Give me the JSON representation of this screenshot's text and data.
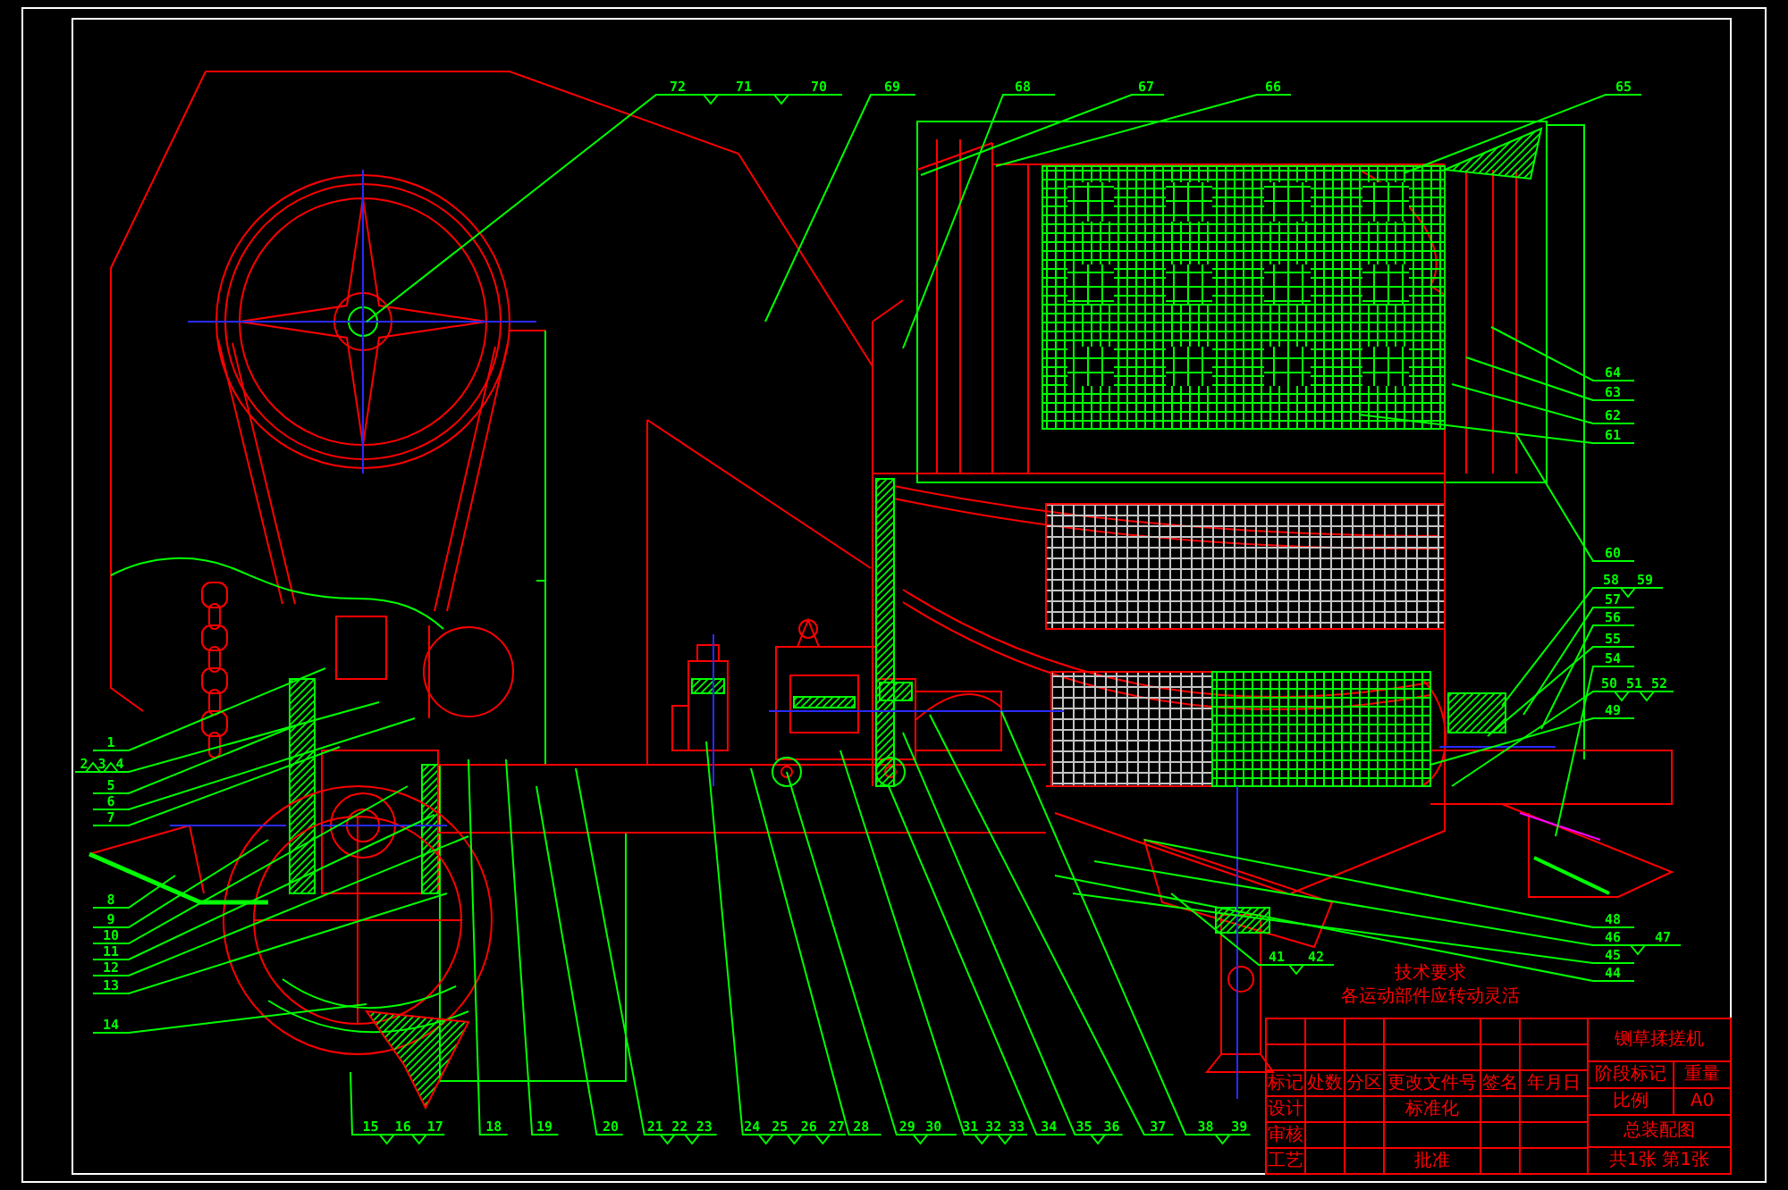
{
  "callouts": {
    "top": [
      {
        "numbers": [
          "72",
          "71",
          "70"
        ]
      },
      {
        "numbers": [
          "69"
        ]
      },
      {
        "numbers": [
          "68"
        ]
      },
      {
        "numbers": [
          "67"
        ]
      },
      {
        "numbers": [
          "66"
        ]
      },
      {
        "numbers": [
          "65"
        ]
      }
    ],
    "left": [
      {
        "numbers": [
          "1"
        ]
      },
      {
        "numbers": [
          "2",
          "3",
          "4"
        ]
      },
      {
        "numbers": [
          "5"
        ]
      },
      {
        "numbers": [
          "6"
        ]
      },
      {
        "numbers": [
          "7"
        ]
      },
      {
        "numbers": [
          "8"
        ]
      },
      {
        "numbers": [
          "9"
        ]
      },
      {
        "numbers": [
          "10"
        ]
      },
      {
        "numbers": [
          "11"
        ]
      },
      {
        "numbers": [
          "12"
        ]
      },
      {
        "numbers": [
          "13"
        ]
      },
      {
        "numbers": [
          "14"
        ]
      }
    ],
    "bottom": [
      {
        "numbers": [
          "15",
          "16",
          "17"
        ]
      },
      {
        "numbers": [
          "18"
        ]
      },
      {
        "numbers": [
          "19"
        ]
      },
      {
        "numbers": [
          "20"
        ]
      },
      {
        "numbers": [
          "21",
          "22",
          "23"
        ]
      },
      {
        "numbers": [
          "24",
          "25",
          "26",
          "27"
        ]
      },
      {
        "numbers": [
          "28"
        ]
      },
      {
        "numbers": [
          "29",
          "30"
        ]
      },
      {
        "numbers": [
          "31",
          "32",
          "33"
        ]
      },
      {
        "numbers": [
          "34"
        ]
      },
      {
        "numbers": [
          "35",
          "36"
        ]
      },
      {
        "numbers": [
          "37"
        ]
      },
      {
        "numbers": [
          "38",
          "39"
        ]
      }
    ],
    "lower_right": [
      {
        "numbers": [
          "41",
          "42"
        ]
      }
    ],
    "right": [
      {
        "numbers": [
          "64"
        ]
      },
      {
        "numbers": [
          "63"
        ]
      },
      {
        "numbers": [
          "62"
        ]
      },
      {
        "numbers": [
          "61"
        ]
      },
      {
        "numbers": [
          "60"
        ]
      },
      {
        "numbers": [
          "58",
          "59"
        ]
      },
      {
        "numbers": [
          "57"
        ]
      },
      {
        "numbers": [
          "56"
        ]
      },
      {
        "numbers": [
          "55"
        ]
      },
      {
        "numbers": [
          "54"
        ]
      },
      {
        "numbers": [
          "50",
          "51",
          "52"
        ]
      },
      {
        "numbers": [
          "49"
        ]
      },
      {
        "numbers": [
          "48"
        ]
      },
      {
        "numbers": [
          "46",
          "47"
        ]
      },
      {
        "numbers": [
          "45"
        ]
      },
      {
        "numbers": [
          "44"
        ]
      }
    ]
  },
  "technical_requirements": {
    "title": "技术要求",
    "text": "各运动部件应转动灵活"
  },
  "title_block": {
    "change_table_headers": [
      "标记",
      "处数",
      "分区",
      "更改文件号",
      "签名",
      "年月日"
    ],
    "signature_rows": [
      {
        "labels": [
          "设计",
          "标准化"
        ]
      },
      {
        "labels": [
          "审核"
        ]
      },
      {
        "labels": [
          "工艺",
          "批准"
        ]
      }
    ],
    "drawing_name": "铡草揉搓机",
    "stage_labels": [
      "阶段标记",
      "重量",
      "比例"
    ],
    "paper_size": "A0",
    "drawing_number": "总装配图",
    "sheet_count": "共1张 第1张"
  }
}
